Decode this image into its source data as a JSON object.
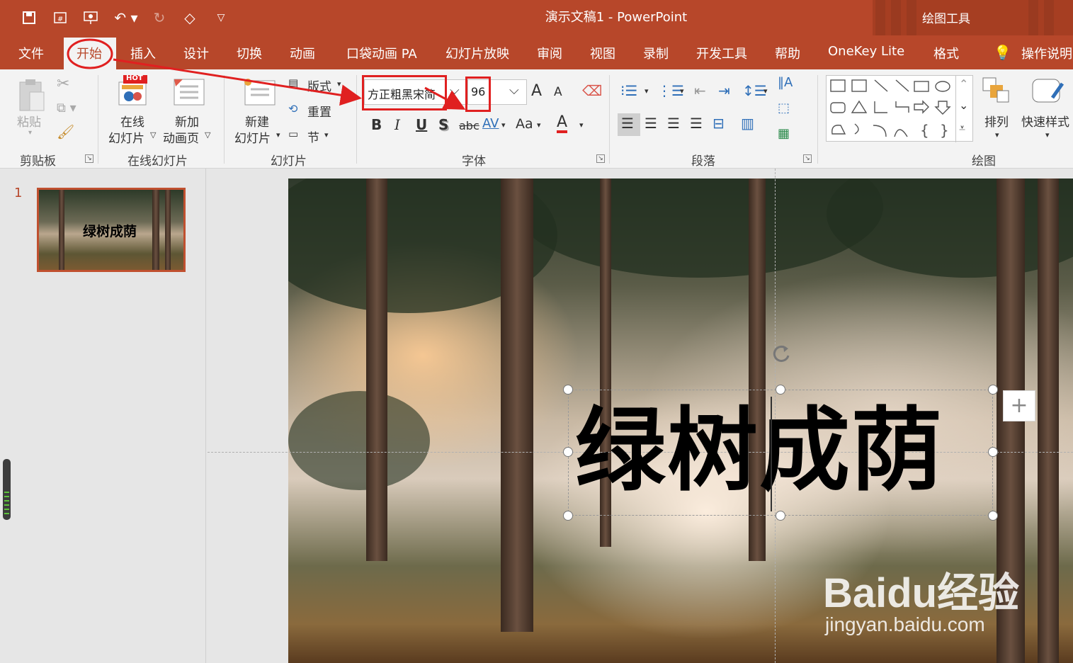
{
  "titlebar": {
    "title": "演示文稿1  -  PowerPoint",
    "context_tools": "绘图工具"
  },
  "tabs": [
    "文件",
    "开始",
    "插入",
    "设计",
    "切换",
    "动画",
    "口袋动画 PA",
    "幻灯片放映",
    "审阅",
    "视图",
    "录制",
    "开发工具",
    "帮助",
    "OneKey Lite",
    "格式",
    "操作说明"
  ],
  "ribbon": {
    "clipboard": {
      "paste": "粘贴",
      "group": "剪贴板"
    },
    "online_slides": {
      "hot_badge": "HOT",
      "online_line1": "在线",
      "online_line2": "幻灯片",
      "add_line1": "新加",
      "add_line2": "动画页",
      "group": "在线幻灯片"
    },
    "slides": {
      "new_line1": "新建",
      "new_line2": "幻灯片",
      "layout": "版式",
      "reset": "重置",
      "section": "节",
      "group": "幻灯片"
    },
    "font": {
      "font_name": "方正粗黑宋简",
      "font_size": "96",
      "bold": "B",
      "italic": "I",
      "underline": "U",
      "shadow": "S",
      "strike": "abc",
      "spacing": "AV",
      "case": "Aa",
      "grow": "A",
      "shrink": "A",
      "color": "A",
      "group": "字体"
    },
    "paragraph": {
      "group": "段落"
    },
    "drawing": {
      "arrange": "排列",
      "quick_styles": "快速样式",
      "group": "绘图"
    }
  },
  "slide_pane": {
    "slide_number": "1",
    "thumb_title": "绿树成荫"
  },
  "slide": {
    "title": "绿树成荫"
  },
  "watermark": {
    "main": "Baidu经验",
    "sub": "jingyan.baidu.com"
  },
  "colors": {
    "accent": "#b7472a",
    "annotation": "#e02020"
  }
}
